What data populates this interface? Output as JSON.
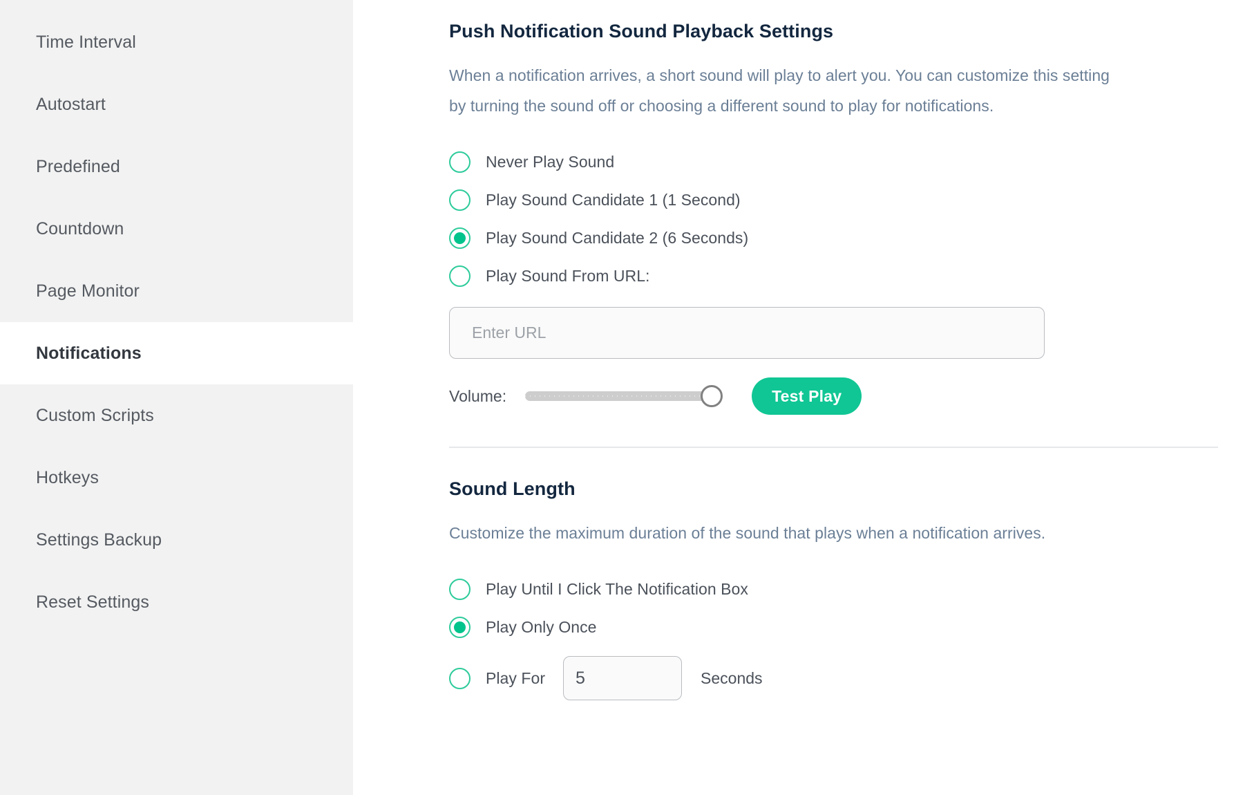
{
  "sidebar": {
    "items": [
      {
        "label": "Time Interval",
        "active": false
      },
      {
        "label": "Autostart",
        "active": false
      },
      {
        "label": "Predefined",
        "active": false
      },
      {
        "label": "Countdown",
        "active": false
      },
      {
        "label": "Page Monitor",
        "active": false
      },
      {
        "label": "Notifications",
        "active": true
      },
      {
        "label": "Custom Scripts",
        "active": false
      },
      {
        "label": "Hotkeys",
        "active": false
      },
      {
        "label": "Settings Backup",
        "active": false
      },
      {
        "label": "Reset Settings",
        "active": false
      }
    ]
  },
  "playback": {
    "title": "Push Notification Sound Playback Settings",
    "description": "When a notification arrives, a short sound will play to alert you. You can customize this setting by turning the sound off or choosing a different sound to play for notifications.",
    "options": [
      {
        "label": "Never Play Sound",
        "selected": false
      },
      {
        "label": "Play Sound Candidate 1 (1 Second)",
        "selected": false
      },
      {
        "label": "Play Sound Candidate 2 (6 Seconds)",
        "selected": true
      },
      {
        "label": "Play Sound From URL:",
        "selected": false
      }
    ],
    "url_field": {
      "value": "",
      "placeholder": "Enter URL"
    },
    "volume_label": "Volume:",
    "volume_value": 100,
    "test_play_label": "Test Play"
  },
  "sound_length": {
    "title": "Sound Length",
    "description": "Customize the maximum duration of the sound that plays when a notification arrives.",
    "options": [
      {
        "label": "Play Until I Click The Notification Box",
        "selected": false
      },
      {
        "label": "Play Only Once",
        "selected": true
      }
    ],
    "play_for": {
      "label": "Play For",
      "value": "5",
      "suffix": "Seconds",
      "selected": false
    }
  },
  "colors": {
    "accent_green": "#10c694",
    "radio_border": "#2ecb9b",
    "heading": "#13273f",
    "muted_text": "#6b7f96",
    "sidebar_bg": "#f2f2f2"
  }
}
